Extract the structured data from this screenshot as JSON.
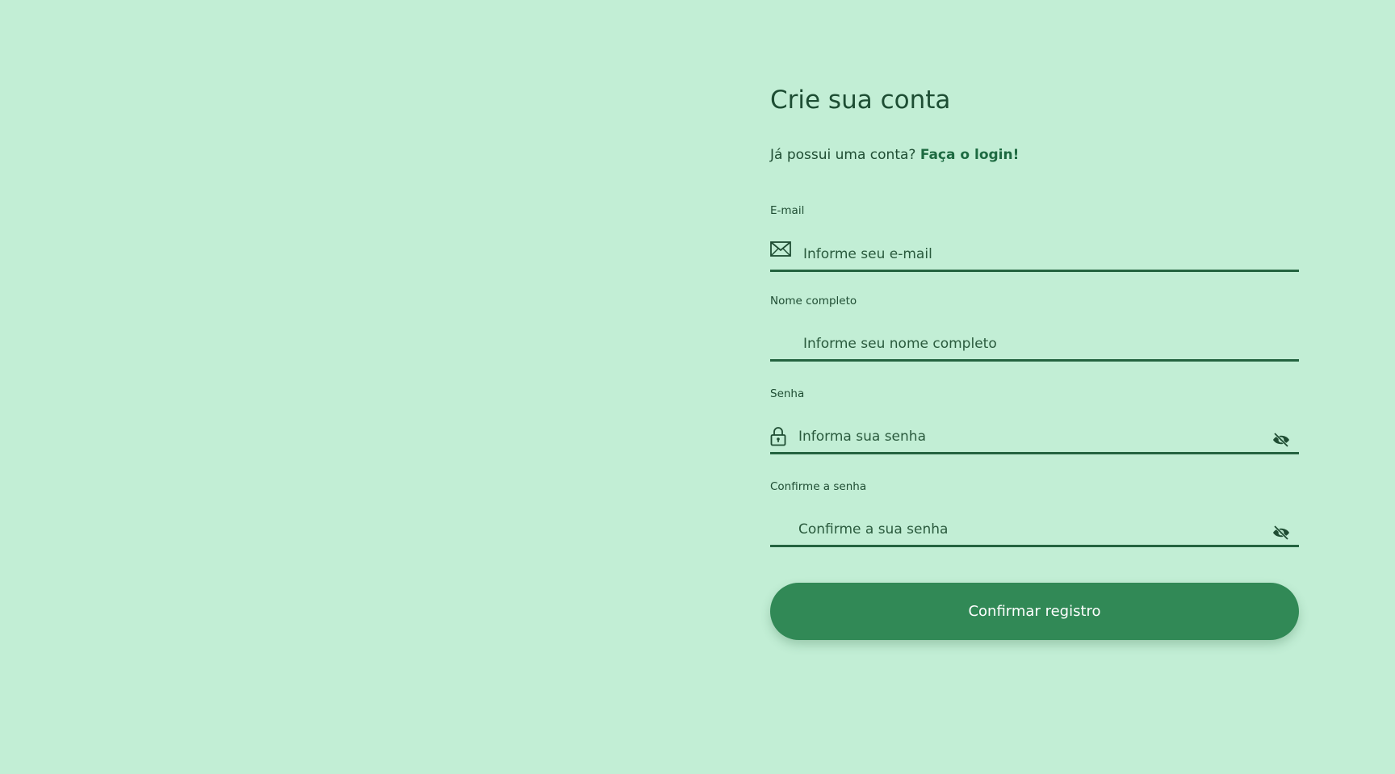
{
  "page": {
    "title": "Crie sua conta",
    "login_prompt": "Já possui uma conta?",
    "login_link": "Faça o login!"
  },
  "fields": {
    "email": {
      "label": "E-mail",
      "placeholder": "Informe seu e-mail",
      "icon": "mail-icon"
    },
    "full_name": {
      "label": "Nome completo",
      "placeholder": "Informe seu nome completo"
    },
    "password": {
      "label": "Senha",
      "placeholder": "Informa sua senha",
      "icon": "lock-icon",
      "toggle_icon": "eye-slash-icon"
    },
    "confirm_password": {
      "label": "Confirme a senha",
      "placeholder": "Confirme a sua senha",
      "toggle_icon": "eye-slash-icon"
    }
  },
  "submit": {
    "label": "Confirmar registro"
  },
  "colors": {
    "background": "#c2eed5",
    "text": "#1f4d33",
    "accent": "#318956",
    "underline": "#246340",
    "button_text": "#ffffff"
  }
}
